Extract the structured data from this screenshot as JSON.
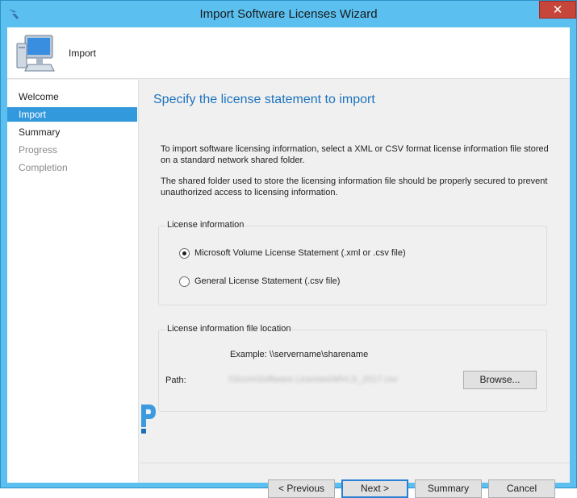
{
  "window": {
    "title": "Import Software Licenses Wizard",
    "close_glyph": "✕",
    "accent": "#5bc0f0",
    "close_color": "#c7463b"
  },
  "header": {
    "title": "Import",
    "icon": "computer-icon"
  },
  "nav": {
    "items": [
      {
        "label": "Welcome",
        "state": "normal"
      },
      {
        "label": "Import",
        "state": "active"
      },
      {
        "label": "Summary",
        "state": "normal"
      },
      {
        "label": "Progress",
        "state": "disabled"
      },
      {
        "label": "Completion",
        "state": "disabled"
      }
    ]
  },
  "main": {
    "heading": "Specify the license statement to import",
    "intro": "To import software licensing information, select a XML or CSV format license information file stored on a standard network shared folder.",
    "security_note": "The shared folder used to store the licensing information file should be properly secured to prevent unauthorized access to licensing information.",
    "license_info": {
      "label": "License information",
      "options": [
        {
          "label": "Microsoft Volume License Statement (.xml or .csv file)",
          "checked": true
        },
        {
          "label": "General License Statement (.csv file)",
          "checked": false
        }
      ]
    },
    "file_location": {
      "label": "License information file location",
      "example": "Example: \\\\servername\\sharename",
      "path_label": "Path:",
      "path_value": "\\\\Sccm\\Software Licenses\\MVLS_2017.csv",
      "browse_label": "Browse..."
    }
  },
  "footer": {
    "previous_label": "< Previous",
    "next_label": "Next >",
    "summary_label": "Summary",
    "cancel_label": "Cancel"
  }
}
